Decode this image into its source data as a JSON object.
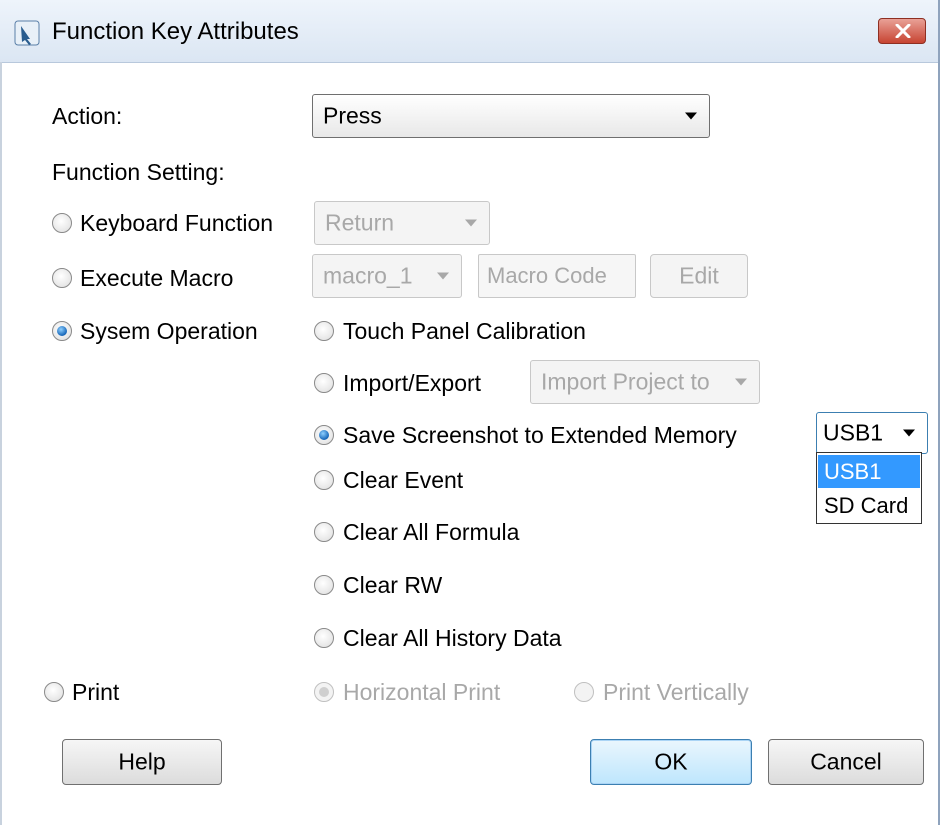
{
  "window": {
    "title": "Function Key Attributes"
  },
  "form": {
    "action_label": "Action:",
    "action_value": "Press",
    "function_setting_label": "Function Setting:",
    "keyboard_function_label": "Keyboard Function",
    "keyboard_function_value": "Return",
    "execute_macro_label": "Execute Macro",
    "macro_value": "macro_1",
    "macro_code_value": "Macro Code",
    "edit_label": "Edit",
    "system_operation_label": "Sysem Operation",
    "touch_panel_calibration_label": "Touch Panel Calibration",
    "import_export_label": "Import/Export",
    "import_export_value": "Import Project to",
    "save_screenshot_label": "Save Screenshot to Extended Memory",
    "memory_value": "USB1",
    "clear_event_label": "Clear Event",
    "clear_all_formula_label": "Clear All Formula",
    "clear_rw_label": "Clear RW",
    "clear_all_history_label": "Clear All History Data",
    "print_label": "Print",
    "horizontal_print_label": "Horizontal Print",
    "print_vertically_label": "Print Vertically"
  },
  "memory_options": [
    "USB1",
    "SD Card"
  ],
  "buttons": {
    "help": "Help",
    "ok": "OK",
    "cancel": "Cancel"
  },
  "selected": {
    "function": "Sysem Operation",
    "system_operation": "Save Screenshot to Extended Memory",
    "print_orientation": "Horizontal Print"
  }
}
